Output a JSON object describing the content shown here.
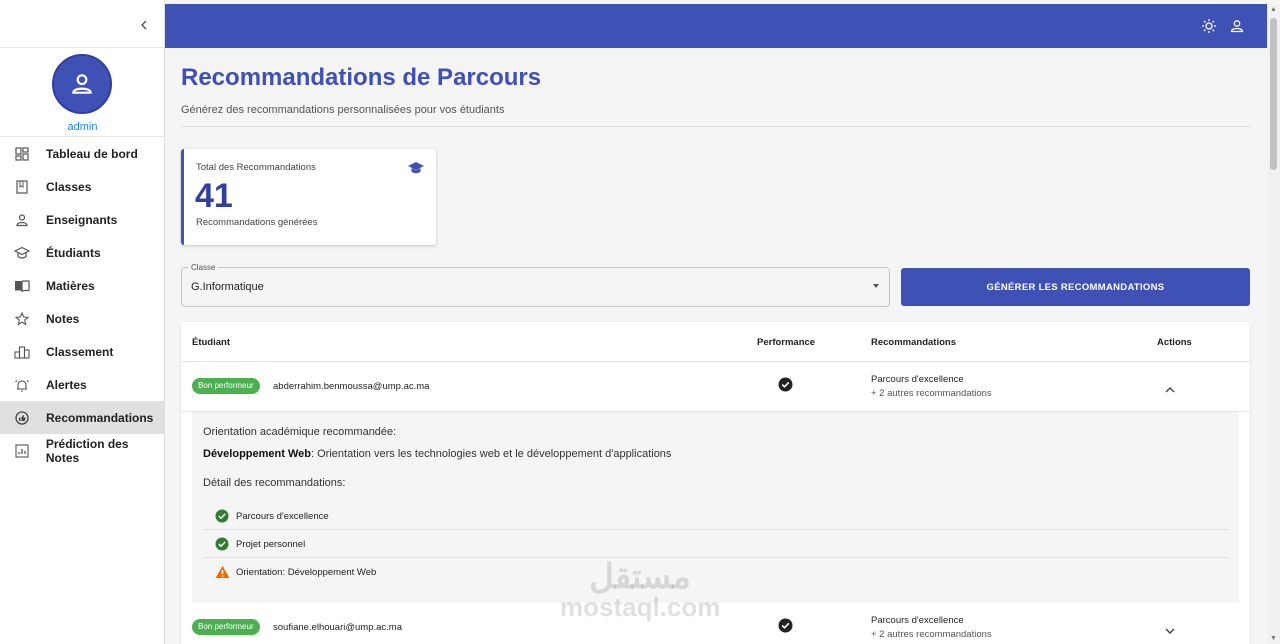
{
  "sidebar": {
    "username": "admin",
    "items": [
      {
        "label": "Tableau de bord",
        "icon": "dashboard-icon"
      },
      {
        "label": "Classes",
        "icon": "book-icon"
      },
      {
        "label": "Enseignants",
        "icon": "person-icon"
      },
      {
        "label": "Étudiants",
        "icon": "school-icon"
      },
      {
        "label": "Matières",
        "icon": "menu-book-icon"
      },
      {
        "label": "Notes",
        "icon": "star-icon"
      },
      {
        "label": "Classement",
        "icon": "leaderboard-icon"
      },
      {
        "label": "Alertes",
        "icon": "alarm-icon"
      },
      {
        "label": "Recommandations",
        "icon": "recommend-icon",
        "active": true
      },
      {
        "label": "Prédiction des Notes",
        "icon": "analytics-icon"
      }
    ]
  },
  "topbar": {
    "color": "#3f51b5",
    "icons": [
      "theme-toggle-icon",
      "account-icon"
    ]
  },
  "page": {
    "title": "Recommandations de Parcours",
    "subtitle": "Générez des recommandations personnalisées pour vos étudiants"
  },
  "stat": {
    "label": "Total des Recommandations",
    "value": "41",
    "caption": "Recommandations générées",
    "icon": "school-icon"
  },
  "filter": {
    "legend": "Classe",
    "value": "G.Informatique"
  },
  "generate_button": "GÉNÉRER LES RECOMMANDATIONS",
  "table": {
    "headers": {
      "student": "Étudiant",
      "performance": "Performance",
      "recommendations": "Recommandations",
      "actions": "Actions"
    },
    "rows": [
      {
        "badge": "Bon performeur",
        "email": "abderrahim.benmoussa@ump.ac.ma",
        "rec_main": "Parcours d'excellence",
        "rec_sub": "+ 2 autres recommandations",
        "expanded": true
      },
      {
        "badge": "Bon performeur",
        "email": "soufiane.elhouari@ump.ac.ma",
        "rec_main": "Parcours d'excellence",
        "rec_sub": "+ 2 autres recommandations",
        "expanded": false
      }
    ],
    "detail": {
      "heading": "Orientation académique recommandée:",
      "orientation_title": "Développement Web",
      "orientation_text": ": Orientation vers les technologies web et le développement d'applications",
      "detail_heading": "Détail des recommandations:",
      "items": [
        {
          "text": "Parcours d'excellence",
          "status": "success"
        },
        {
          "text": "Projet personnel",
          "status": "success"
        },
        {
          "text": "Orientation: Développement Web",
          "status": "warning"
        }
      ]
    }
  },
  "watermark": {
    "arabic": "مستقل",
    "latin": "mostaql.com"
  }
}
